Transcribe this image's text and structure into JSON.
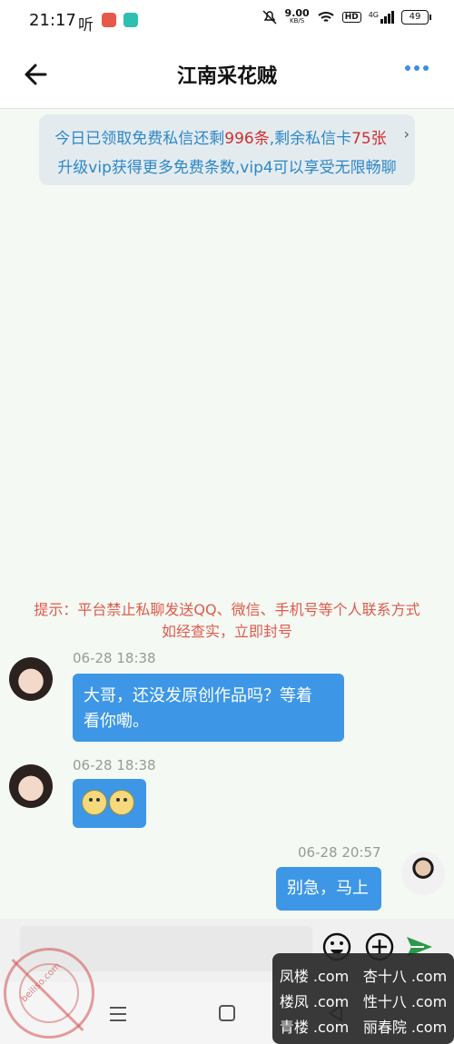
{
  "status_bar": {
    "time": "21:17",
    "app_label": "听",
    "net_speed": "9.00",
    "net_unit": "KB/S",
    "hd_label": "HD",
    "signal_label": "4G",
    "battery": "49"
  },
  "header": {
    "title": "江南采花贼"
  },
  "quota": {
    "line1_prefix": "今日已领取免费私信还剩",
    "free_count": "996条",
    "line1_mid": ",剩余私信卡",
    "card_count": "75张",
    "line2": "升级vip获得更多免费条数,vip4可以享受无限畅聊",
    "arrow": "›"
  },
  "notice": {
    "line1": "提示：平台禁止私聊发送QQ、微信、手机号等个人联系方式",
    "line2": "如经查实，立即封号"
  },
  "messages": [
    {
      "time": "06-28 18:38",
      "text": "大哥，还没发原创作品吗？等着看你嘞。",
      "line1": "大哥，还没发原创作品吗？等着",
      "line2": "看你嘞。"
    },
    {
      "time": "06-28 18:38",
      "text": ""
    },
    {
      "time": "06-28 20:57",
      "text": "别急，马上"
    }
  ],
  "input": {
    "value": ""
  },
  "watermark": {
    "r1a": "凤楼 .com",
    "r1b": "杏十八 .com",
    "r2a": "楼凤 .com",
    "r2b": "性十八 .com",
    "r3a": "青楼 .com",
    "r3b": "丽春院 .com",
    "stamp": "beiliso.com"
  },
  "colors": {
    "accent": "#3d97e6",
    "notice": "#e05a4a",
    "highlight": "#cc2f2f",
    "link": "#2c87c8"
  }
}
